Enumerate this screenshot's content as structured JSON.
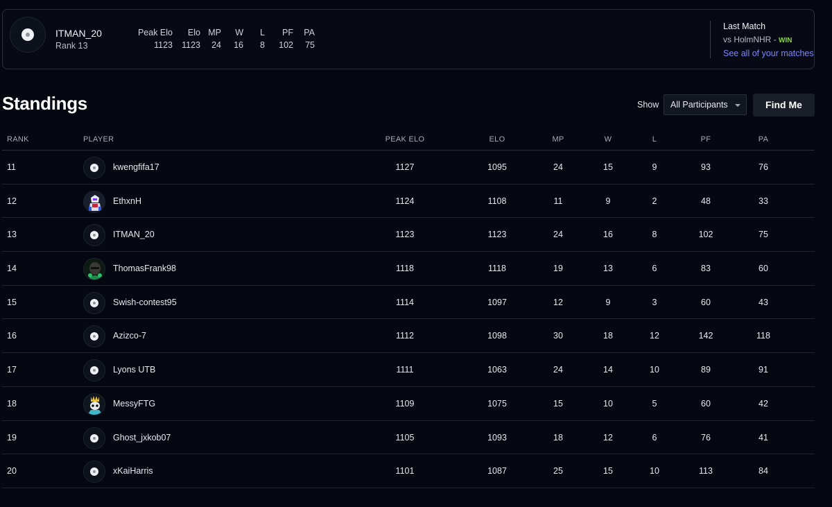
{
  "player_card": {
    "name": "ITMAN_20",
    "rank": "Rank 13",
    "stats": [
      {
        "label": "Peak Elo",
        "value": "1123"
      },
      {
        "label": "Elo",
        "value": "1123"
      },
      {
        "label": "MP",
        "value": "24"
      },
      {
        "label": "W",
        "value": "16"
      },
      {
        "label": "L",
        "value": "8"
      },
      {
        "label": "PF",
        "value": "102"
      },
      {
        "label": "PA",
        "value": "75"
      }
    ],
    "last_match": {
      "title": "Last Match",
      "opponent": "vs HolmNHR",
      "separator": "-",
      "result": "WIN",
      "link": "See all of your matches"
    }
  },
  "standings": {
    "title": "Standings",
    "show_label": "Show",
    "filter_value": "All Participants",
    "find_me_label": "Find Me",
    "columns": [
      "RANK",
      "PLAYER",
      "PEAK ELO",
      "ELO",
      "MP",
      "W",
      "L",
      "PF",
      "PA"
    ],
    "rows": [
      {
        "rank": "11",
        "player": "kwengfifa17",
        "avatar": "soccer-ball-icon",
        "peak_elo": "1127",
        "elo": "1095",
        "mp": "24",
        "w": "15",
        "l": "9",
        "pf": "93",
        "pa": "76"
      },
      {
        "rank": "12",
        "player": "EthxnH",
        "avatar": "robot-avatar",
        "peak_elo": "1124",
        "elo": "1108",
        "mp": "11",
        "w": "9",
        "l": "2",
        "pf": "48",
        "pa": "33"
      },
      {
        "rank": "13",
        "player": "ITMAN_20",
        "avatar": "soccer-ball-icon",
        "peak_elo": "1123",
        "elo": "1123",
        "mp": "24",
        "w": "16",
        "l": "8",
        "pf": "102",
        "pa": "75"
      },
      {
        "rank": "14",
        "player": "ThomasFrank98",
        "avatar": "masked-face-avatar",
        "peak_elo": "1118",
        "elo": "1118",
        "mp": "19",
        "w": "13",
        "l": "6",
        "pf": "83",
        "pa": "60"
      },
      {
        "rank": "15",
        "player": "Swish-contest95",
        "avatar": "soccer-ball-icon",
        "peak_elo": "1114",
        "elo": "1097",
        "mp": "12",
        "w": "9",
        "l": "3",
        "pf": "60",
        "pa": "43"
      },
      {
        "rank": "16",
        "player": "Azizco-7",
        "avatar": "soccer-ball-icon",
        "peak_elo": "1112",
        "elo": "1098",
        "mp": "30",
        "w": "18",
        "l": "12",
        "pf": "142",
        "pa": "118"
      },
      {
        "rank": "17",
        "player": "Lyons UTB",
        "avatar": "soccer-ball-icon",
        "peak_elo": "1111",
        "elo": "1063",
        "mp": "24",
        "w": "14",
        "l": "10",
        "pf": "89",
        "pa": "91"
      },
      {
        "rank": "18",
        "player": "MessyFTG",
        "avatar": "crowned-skull-avatar",
        "peak_elo": "1109",
        "elo": "1075",
        "mp": "15",
        "w": "10",
        "l": "5",
        "pf": "60",
        "pa": "42"
      },
      {
        "rank": "19",
        "player": "Ghost_jxkob07",
        "avatar": "soccer-ball-icon",
        "peak_elo": "1105",
        "elo": "1093",
        "mp": "18",
        "w": "12",
        "l": "6",
        "pf": "76",
        "pa": "41"
      },
      {
        "rank": "20",
        "player": "xKaiHarris",
        "avatar": "soccer-ball-icon",
        "peak_elo": "1101",
        "elo": "1087",
        "mp": "25",
        "w": "15",
        "l": "10",
        "pf": "113",
        "pa": "84"
      }
    ]
  },
  "colors": {
    "background": "#050811",
    "win": "#8fd14f",
    "link": "#7e86f5"
  }
}
